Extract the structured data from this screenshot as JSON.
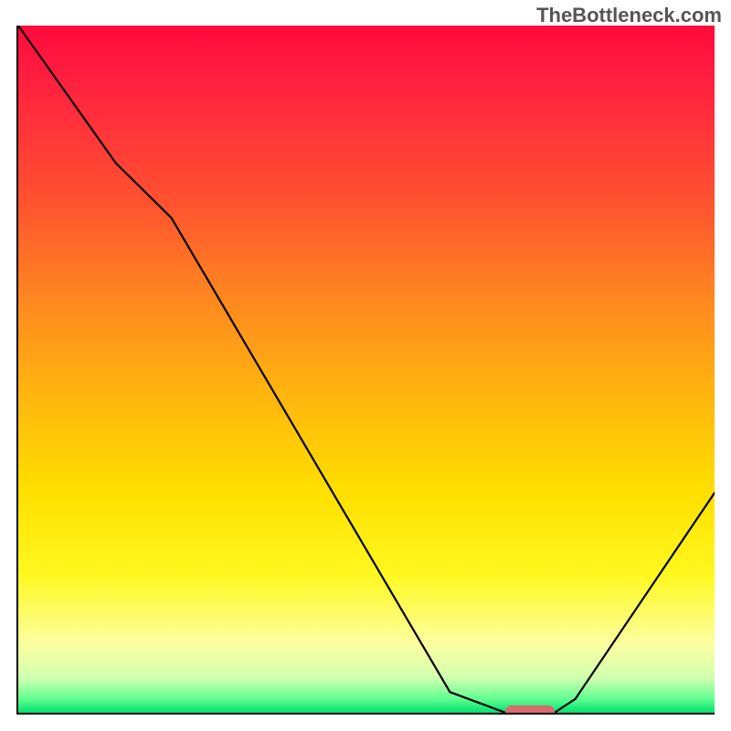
{
  "watermark": "TheBottleneck.com",
  "chart_data": {
    "type": "line",
    "title": "",
    "xlabel": "",
    "ylabel": "",
    "xlim": [
      0,
      100
    ],
    "ylim": [
      0,
      100
    ],
    "grid": false,
    "legend": false,
    "series": [
      {
        "name": "curve",
        "x": [
          0,
          14,
          22,
          62,
          70,
          77,
          80,
          100
        ],
        "values": [
          100,
          80,
          72,
          3,
          0,
          0,
          2,
          32
        ]
      }
    ],
    "marker": {
      "x_start": 70,
      "x_end": 77,
      "y": 0,
      "color": "#d96a6e"
    },
    "background_gradient": {
      "top": "#ff0a3c",
      "bottom": "#00e070"
    }
  }
}
